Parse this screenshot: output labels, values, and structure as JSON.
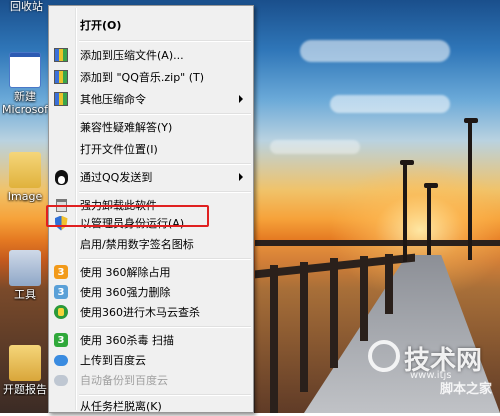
{
  "desktop": {
    "top_label": "回收站",
    "icons": [
      {
        "label": "新建 Microsof",
        "icon": "word-document-icon"
      },
      {
        "label": "Image",
        "icon": "folder-icon"
      },
      {
        "label": "工具",
        "icon": "folder-icon"
      },
      {
        "label": "开题报告",
        "icon": "folder-icon"
      }
    ]
  },
  "context_menu": {
    "items": [
      {
        "label": "打开(O)",
        "icon": "",
        "bold": true
      },
      {
        "separator": true
      },
      {
        "label": "添加到压缩文件(A)...",
        "icon": "winrar-archive-icon"
      },
      {
        "label": "添加到 \"QQ音乐.zip\" (T)",
        "icon": "winrar-archive-icon"
      },
      {
        "label": "其他压缩命令",
        "icon": "winrar-archive-icon",
        "submenu": true
      },
      {
        "separator": true
      },
      {
        "label": "兼容性疑难解答(Y)",
        "icon": ""
      },
      {
        "label": "打开文件位置(I)",
        "icon": ""
      },
      {
        "separator": true
      },
      {
        "label": "通过QQ发送到",
        "icon": "qq-penguin-icon",
        "submenu": true
      },
      {
        "separator": true
      },
      {
        "label": "强力卸载此软件",
        "icon": "trash-icon"
      },
      {
        "label": "以管理员身份运行(A)",
        "icon": "uac-shield-icon",
        "highlighted": true
      },
      {
        "label": "启用/禁用数字签名图标",
        "icon": ""
      },
      {
        "separator": true
      },
      {
        "label": "使用 360解除占用",
        "icon": "360-unlock-icon"
      },
      {
        "label": "使用 360强力删除",
        "icon": "360-delete-icon"
      },
      {
        "label": "使用360进行木马云查杀",
        "icon": "360-trojan-scan-icon"
      },
      {
        "separator": true
      },
      {
        "label": "使用 360杀毒 扫描",
        "icon": "360-antivirus-icon"
      },
      {
        "label": "上传到百度云",
        "icon": "baidu-cloud-icon"
      },
      {
        "label": "自动备份到百度云",
        "icon": "baidu-cloud-icon",
        "disabled": true
      },
      {
        "separator": true
      },
      {
        "label": "从任务栏脱离(K)",
        "icon": ""
      }
    ]
  },
  "watermark": {
    "main": "技术网",
    "sub": "www.itjs",
    "small": "脚本之家"
  }
}
